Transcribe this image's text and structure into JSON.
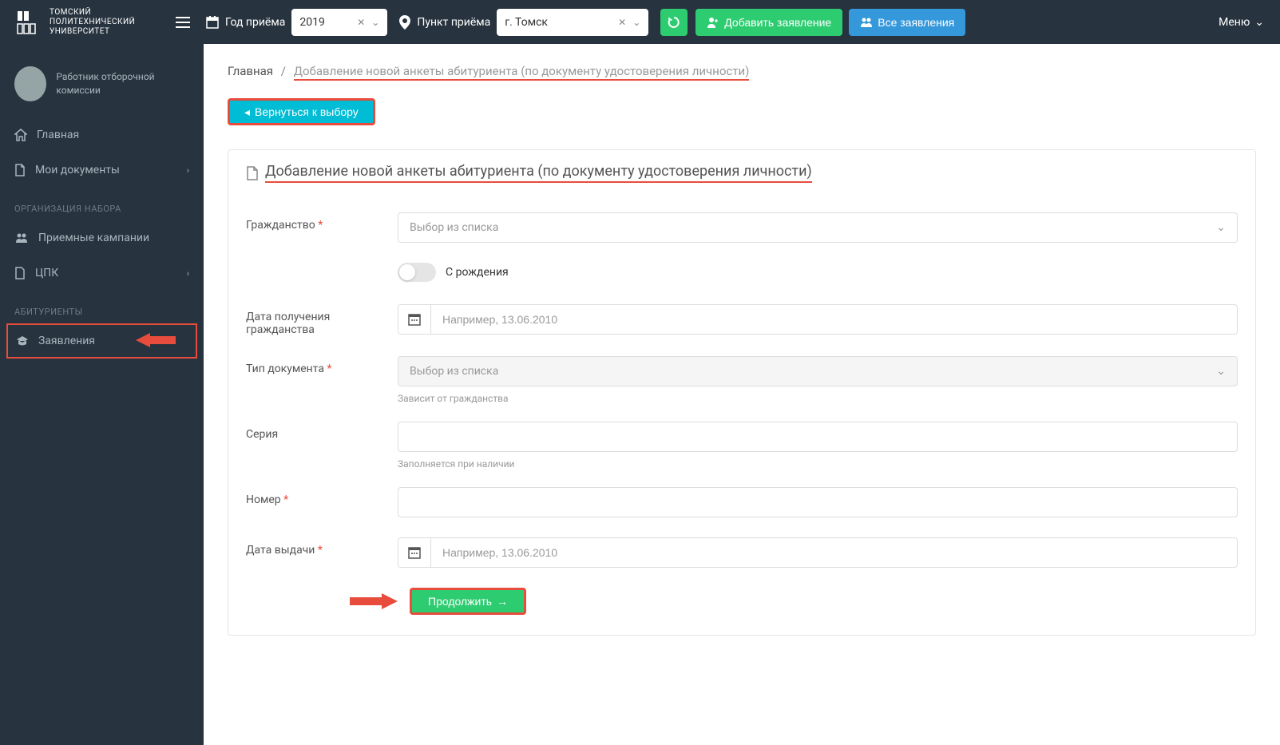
{
  "logo": {
    "line1": "ТОМСКИЙ",
    "line2": "ПОЛИТЕХНИЧЕСКИЙ",
    "line3": "УНИВЕРСИТЕТ"
  },
  "header": {
    "year_label": "Год приёма",
    "year_value": "2019",
    "point_label": "Пункт приёма",
    "point_value": "г. Томск",
    "add_app": "Добавить заявление",
    "all_apps": "Все заявления",
    "menu": "Меню"
  },
  "sidebar": {
    "user_role": "Работник отборочной комиссии",
    "items": {
      "home": "Главная",
      "mydocs": "Мои документы",
      "section1": "ОРГАНИЗАЦИЯ НАБОРА",
      "campaigns": "Приемные кампании",
      "cpk": "ЦПК",
      "section2": "АБИТУРИЕНТЫ",
      "applications": "Заявления"
    }
  },
  "breadcrumb": {
    "home": "Главная",
    "sep": "/",
    "current": "Добавление новой анкеты абитуриента (по документу удостоверения личности)"
  },
  "back_btn": "Вернуться к выбору",
  "panel_title": "Добавление новой анкеты абитуриента (по документу удостоверения личности)",
  "form": {
    "citizenship": {
      "label": "Гражданство",
      "placeholder": "Выбор из списка"
    },
    "from_birth": "С рождения",
    "citizenship_date": {
      "label": "Дата получения гражданства",
      "placeholder": "Например, 13.06.2010"
    },
    "doc_type": {
      "label": "Тип документа",
      "placeholder": "Выбор из списка",
      "help": "Зависит от гражданства"
    },
    "series": {
      "label": "Серия",
      "help": "Заполняется при наличии"
    },
    "number": {
      "label": "Номер"
    },
    "issue_date": {
      "label": "Дата выдачи",
      "placeholder": "Например, 13.06.2010"
    },
    "submit": "Продолжить"
  }
}
